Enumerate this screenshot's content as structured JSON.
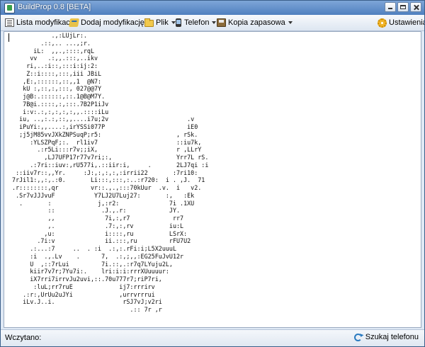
{
  "window": {
    "title": "BuildProp 0.8 [BETA]"
  },
  "toolbar": {
    "list_mods": "Lista modyfikacji",
    "add_mod": "Dodaj modyfikację",
    "file": "Plik",
    "phone": "Telefon",
    "backup": "Kopia zapasowa",
    "settings": "Ustawienia"
  },
  "content": {
    "ascii_art": "            .,:LUjLr:.\n         .::,.. ...,;r.\n       iL:  ,,.,::::,rqL\n      vv   .:,,.:::,..ikv\n     ri,..:i::,:::i:ij:2:\n     Z::i::::,:::,iii JBiL\n    ,E:,::::::,::,,1  @N7:\n    kU :,::,:,:::, 027@@7Y\n    j@B:.::::::,::.1@B@M7Y.\n    7B@i.::::,:,:::.7B2P1iJv\n    i:v:.:,:,:,:,:,,.::::iLu\n   iu, ..,:.:,::,,....i7u;2v                      .v\n   iPuYi:,,....:,irYSSi077P                       iE0\n   ;j5jM85vvJXkZNPSuqP;r5:                     , rSk.\n      :YLSZPqF;:.  rl1iv7                      ::iu7k,\n        .:r5Li:::r7v;;iX,                      r ,LLrY\n          ,LJ7UFP17r77v7ri;:,                  Yrr7L rS.\n      .:7ri::iuv:,rU577i,.::iir:i,     .       2LJ7qi :i\n  ::iiv7r::,,Yr.     :J:,:,:,:,:irrii22       :7ri10:\n 7rJil1:,,:,.:0.       Li:::,:::,:..:r720:  i . ,J.  71\n .r::::::::,qr         vr::.,.,:::70kUur  .v.  i   v2.\n  .Sr7vJJJvuF           Y7LJ2U7Luj27:       :,   :Ek\n   .       :             j,:r2:              7i .1XU\n           ::             .J.,.r:            JY.\n           ,,              7i,:,r7            rr7\n           ,.              .7:,:,rv          iu:L\n          ,u:              i::::,ru          LSrX:\n        .7i:v              ii.:::,ru         rFU7U2\n      .:...:7     ..  . :i  .:,:.rFi:i;L5X2uuuL\n      :i  .,.Lv    .      7,  .:,;,,:EG25FuJvU12r\n      U  ,::7rLui         7i.::,.:r7q7LYuju2L,\n      kiir7v7r;7Yu7i:.    lri:i:i:rrrXUuuuur:\n      iX7rri7irrvJu2uvi,::.70u777r7;riP7ri,\n       :luL;rr7ruE             ij7:rrrirv\n    .:r:,UrUu2uJYi             ,urrvrrrui\n    iLv.J..i.                   rSJ7vJ;v2ri\n                                  .:: 7r ,r"
  },
  "status": {
    "loaded_label": "Wczytano:",
    "search_phone": "Szukaj telefonu"
  }
}
